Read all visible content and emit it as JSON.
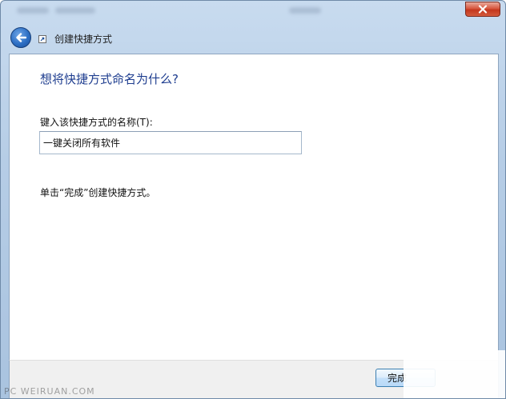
{
  "window": {
    "title": "创建快捷方式"
  },
  "page": {
    "heading": "想将快捷方式命名为什么?",
    "name_label": "键入该快捷方式的名称(T):",
    "name_value": "一键关闭所有软件",
    "instruction": "单击“完成”创建快捷方式。"
  },
  "footer": {
    "finish_label": "完成"
  },
  "watermarks": {
    "left": "PC WEIRUAN.COM"
  },
  "colors": {
    "heading": "#1e3d8f",
    "close_button": "#c3371e",
    "back_button": "#2d6fc4"
  }
}
